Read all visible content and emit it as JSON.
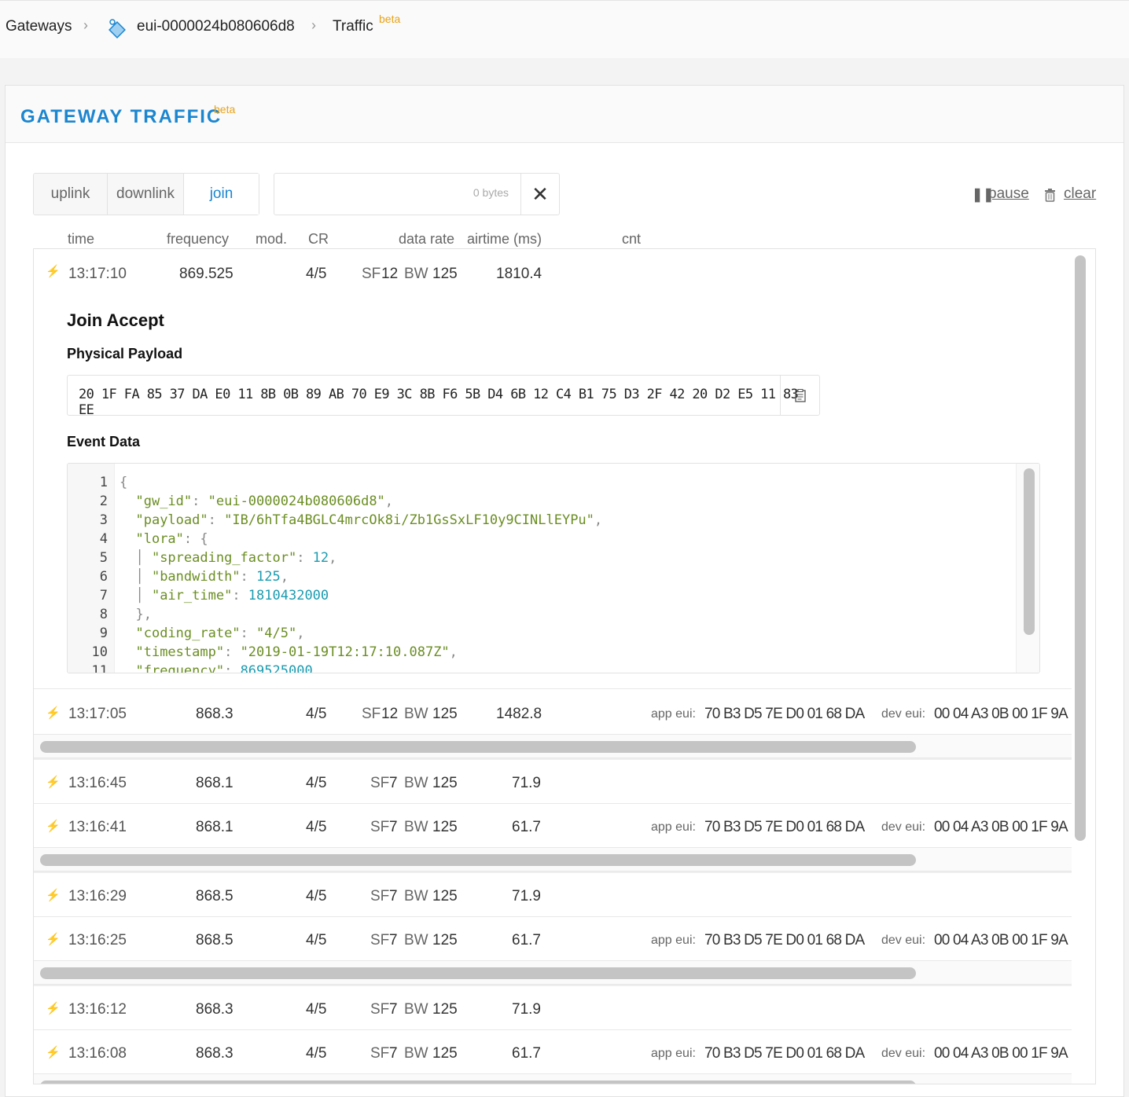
{
  "breadcrumb": {
    "gateways": "Gateways",
    "gateway_id": "eui-0000024b080606d8",
    "traffic": "Traffic",
    "beta": "beta"
  },
  "card": {
    "title": "GATEWAY TRAFFIC",
    "beta": "beta"
  },
  "tabs": [
    {
      "label": "uplink",
      "active": false
    },
    {
      "label": "downlink",
      "active": false
    },
    {
      "label": "join",
      "active": true
    }
  ],
  "filter": {
    "bytes": "0 bytes"
  },
  "controls": {
    "pause": "pause",
    "clear": "clear"
  },
  "columns": {
    "time": "time",
    "frequency": "frequency",
    "mod": "mod.",
    "cr": "CR",
    "data_rate": "data rate",
    "airtime": "airtime (ms)",
    "cnt": "cnt"
  },
  "expanded": {
    "time": "13:17:10",
    "frequency": "869.525",
    "cr": "4/5",
    "sf": "12",
    "bw": "125",
    "airtime": "1810.4",
    "title": "Join Accept",
    "physical_payload_label": "Physical Payload",
    "physical_payload": "20 1F FA 85 37 DA E0 11 8B 0B 89 AB 70 E9 3C 8B F6 5B D4 6B 12 C4 B1 75 D3 2F 42 20 D2 E5 11 83 EE",
    "event_data_label": "Event Data",
    "line_numbers": [
      "1",
      "2",
      "3",
      "4",
      "5",
      "6",
      "7",
      "8",
      "9",
      "10",
      "11"
    ]
  },
  "labels": {
    "sf": "SF",
    "bw": "BW",
    "app_eui": "app eui:",
    "dev_eui": "dev eui:"
  },
  "rows": [
    {
      "time": "13:17:05",
      "frequency": "868.3",
      "cr": "4/5",
      "sf": "12",
      "bw": "125",
      "airtime": "1482.8",
      "app_eui": "70 B3 D5 7E D0 01 68 DA",
      "dev_eui": "00 04 A3 0B 00 1F 9A"
    },
    {
      "time": "13:16:45",
      "frequency": "868.1",
      "cr": "4/5",
      "sf": "7",
      "bw": "125",
      "airtime": "71.9"
    },
    {
      "time": "13:16:41",
      "frequency": "868.1",
      "cr": "4/5",
      "sf": "7",
      "bw": "125",
      "airtime": "61.7",
      "app_eui": "70 B3 D5 7E D0 01 68 DA",
      "dev_eui": "00 04 A3 0B 00 1F 9A"
    },
    {
      "time": "13:16:29",
      "frequency": "868.5",
      "cr": "4/5",
      "sf": "7",
      "bw": "125",
      "airtime": "71.9"
    },
    {
      "time": "13:16:25",
      "frequency": "868.5",
      "cr": "4/5",
      "sf": "7",
      "bw": "125",
      "airtime": "61.7",
      "app_eui": "70 B3 D5 7E D0 01 68 DA",
      "dev_eui": "00 04 A3 0B 00 1F 9A"
    },
    {
      "time": "13:16:12",
      "frequency": "868.3",
      "cr": "4/5",
      "sf": "7",
      "bw": "125",
      "airtime": "71.9"
    },
    {
      "time": "13:16:08",
      "frequency": "868.3",
      "cr": "4/5",
      "sf": "7",
      "bw": "125",
      "airtime": "61.7",
      "app_eui": "70 B3 D5 7E D0 01 68 DA",
      "dev_eui": "00 04 A3 0B 00 1F 9A"
    }
  ],
  "colors": {
    "accent": "#1b86d0",
    "beta": "#e8a317",
    "uplink_bolt": "#4cd964",
    "downlink_bolt": "#f5b82e",
    "json_string": "#6b8e23",
    "json_number": "#1a9bb0"
  }
}
